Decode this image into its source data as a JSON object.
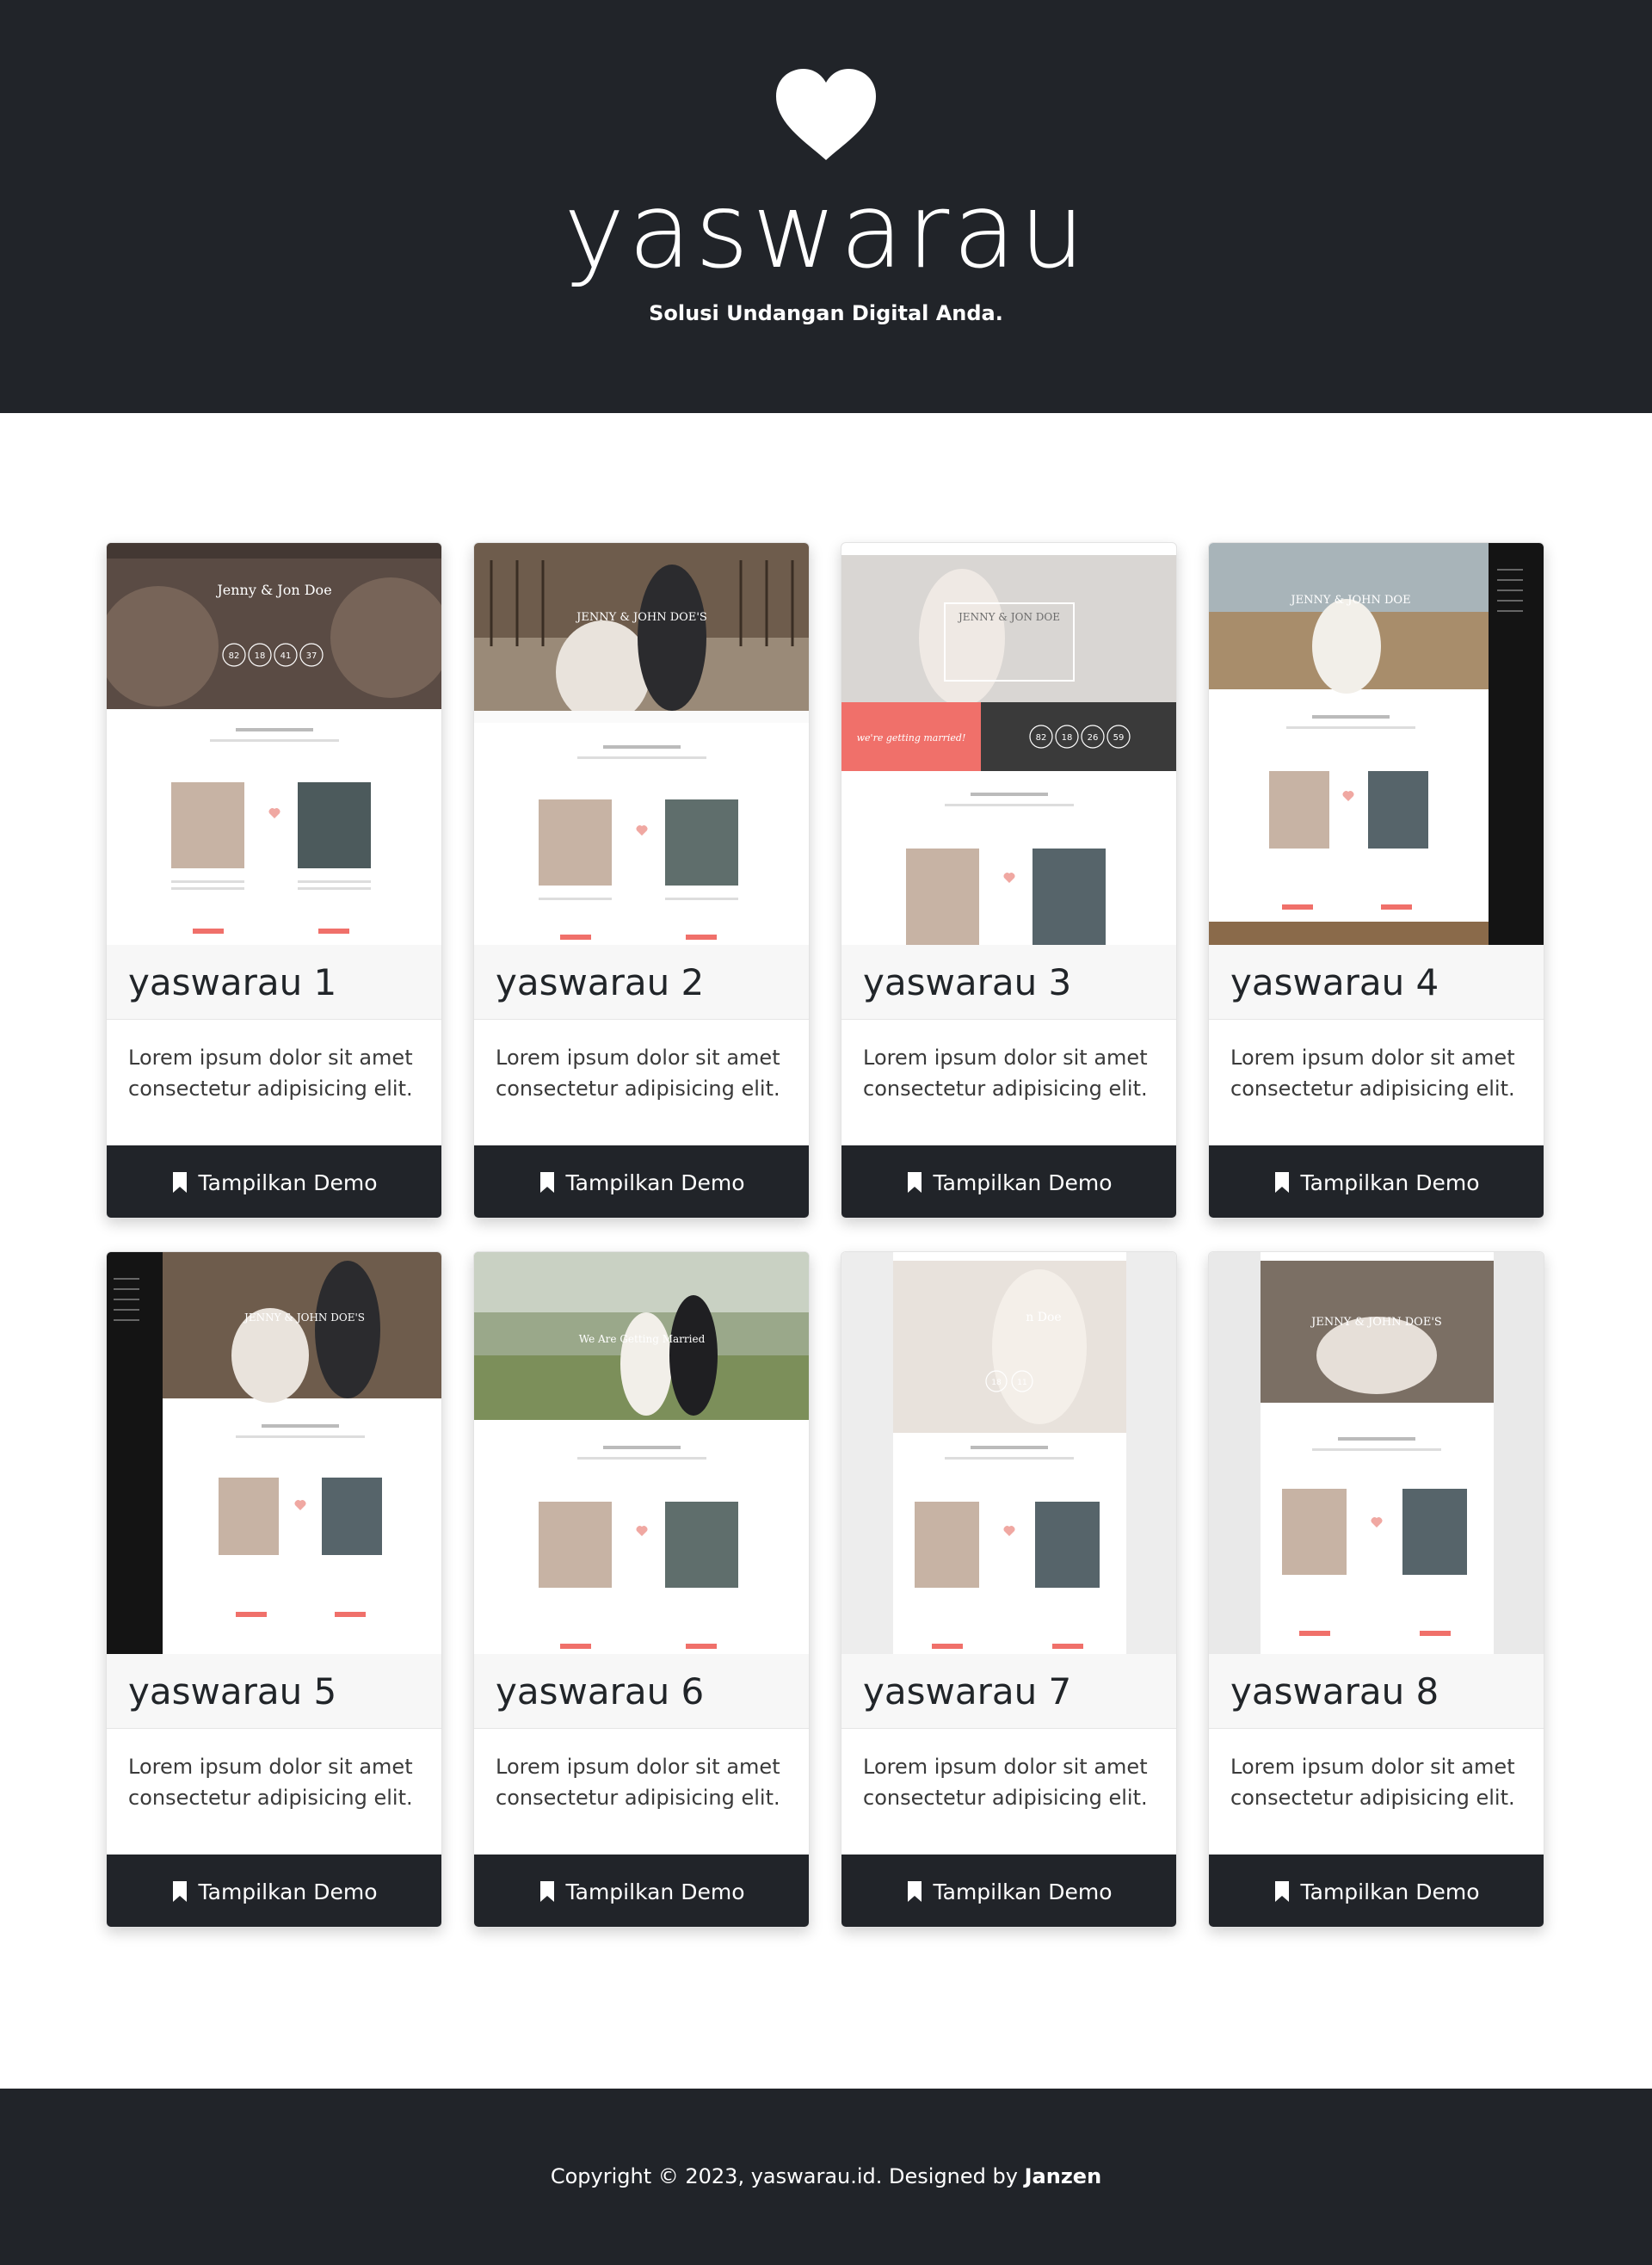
{
  "header": {
    "brand": "yaswarau",
    "tagline": "Solusi Undangan Digital Anda."
  },
  "cards": [
    {
      "title": "yaswarau 1",
      "description": "Lorem ipsum dolor sit amet consectetur adipisicing elit.",
      "button": "Tampilkan Demo",
      "preview": {
        "heading": "Jenny & Jon Doe",
        "countdown": [
          "82",
          "18",
          "41",
          "37"
        ]
      }
    },
    {
      "title": "yaswarau 2",
      "description": "Lorem ipsum dolor sit amet consectetur adipisicing elit.",
      "button": "Tampilkan Demo",
      "preview": {
        "heading": "JENNY & JOHN DOE'S"
      }
    },
    {
      "title": "yaswarau 3",
      "description": "Lorem ipsum dolor sit amet consectetur adipisicing elit.",
      "button": "Tampilkan Demo",
      "preview": {
        "heading": "JENNY & JON DOE",
        "banner": "we're getting married!",
        "countdown": [
          "82",
          "18",
          "26",
          "59"
        ]
      }
    },
    {
      "title": "yaswarau 4",
      "description": "Lorem ipsum dolor sit amet consectetur adipisicing elit.",
      "button": "Tampilkan Demo",
      "preview": {
        "heading": "JENNY & JOHN DOE"
      }
    },
    {
      "title": "yaswarau 5",
      "description": "Lorem ipsum dolor sit amet consectetur adipisicing elit.",
      "button": "Tampilkan Demo",
      "preview": {
        "heading": "JENNY & JOHN DOE'S"
      }
    },
    {
      "title": "yaswarau 6",
      "description": "Lorem ipsum dolor sit amet consectetur adipisicing elit.",
      "button": "Tampilkan Demo",
      "preview": {
        "heading": "We Are Getting Married"
      }
    },
    {
      "title": "yaswarau 7",
      "description": "Lorem ipsum dolor sit amet consectetur adipisicing elit.",
      "button": "Tampilkan Demo",
      "preview": {
        "heading": "n Doe",
        "countdown": [
          "18",
          "11"
        ]
      }
    },
    {
      "title": "yaswarau 8",
      "description": "Lorem ipsum dolor sit amet consectetur adipisicing elit.",
      "button": "Tampilkan Demo",
      "preview": {
        "heading": "JENNY & JOHN DOE'S"
      }
    }
  ],
  "footer": {
    "text": "Copyright © 2023, yaswarau.id. Designed by",
    "author": "Janzen"
  },
  "colors": {
    "dark": "#212429",
    "accent": "#f0706a",
    "white": "#ffffff"
  },
  "icons": {
    "logo": "heart-icon",
    "button": "bookmark-icon"
  }
}
